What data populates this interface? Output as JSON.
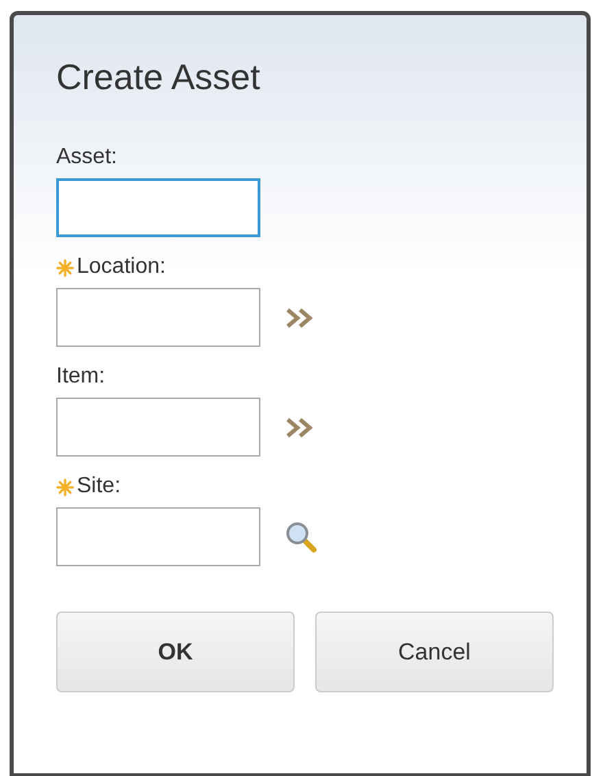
{
  "dialog": {
    "title": "Create Asset"
  },
  "fields": [
    {
      "label": "Asset:",
      "required": false,
      "focused": true,
      "kind": "plain"
    },
    {
      "label": "Location:",
      "required": true,
      "focused": false,
      "kind": "detail"
    },
    {
      "label": "Item:",
      "required": false,
      "focused": false,
      "kind": "detail"
    },
    {
      "label": "Site:",
      "required": true,
      "focused": false,
      "kind": "lookup"
    }
  ],
  "buttons": [
    {
      "label": "OK",
      "primary": true
    },
    {
      "label": "Cancel",
      "primary": false
    }
  ]
}
